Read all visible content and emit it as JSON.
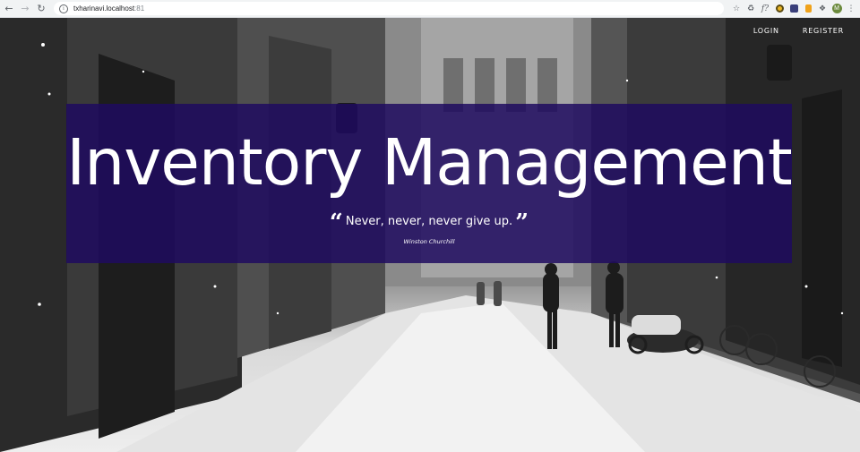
{
  "browser": {
    "back_icon": "back-arrow-icon",
    "forward_icon": "forward-arrow-icon",
    "reload_icon": "reload-icon",
    "url_host": "txharinavi.localhost",
    "url_port": ":81",
    "avatar_letter": "M"
  },
  "nav": {
    "login": "LOGIN",
    "register": "REGISTER"
  },
  "hero": {
    "title": "Inventory Management",
    "quote": "Never, never, never give up.",
    "open_quote": "“",
    "close_quote": "”",
    "author": "Winston Churchill",
    "banner_color": "#1e0a5f"
  }
}
